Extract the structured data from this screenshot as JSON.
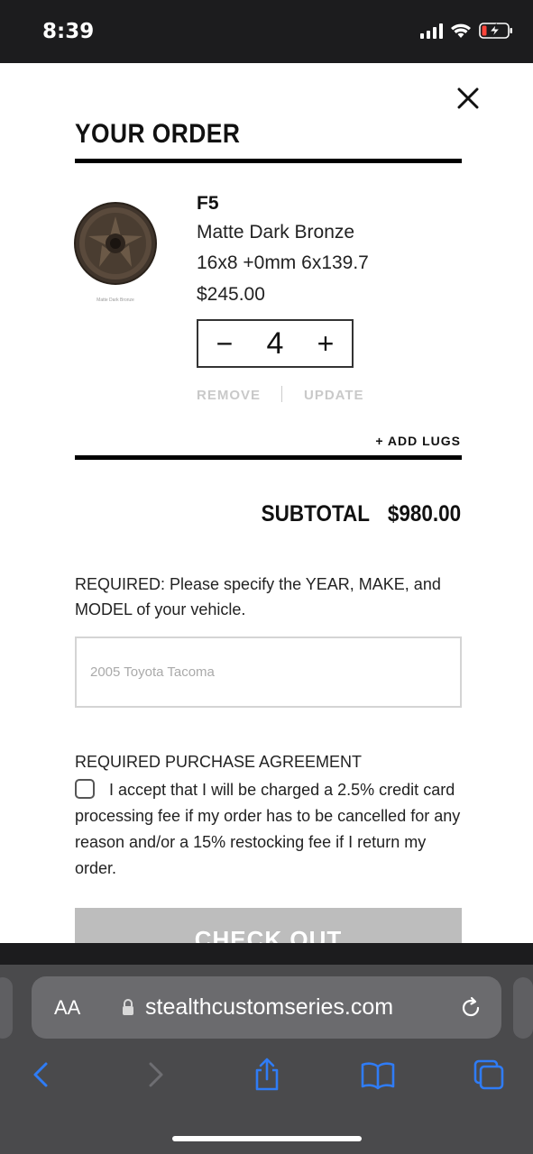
{
  "status_bar": {
    "time": "8:39"
  },
  "order": {
    "title": "YOUR ORDER",
    "item": {
      "name": "F5",
      "finish": "Matte Dark Bronze",
      "spec": "16x8 +0mm 6x139.7",
      "price": "$245.00",
      "image_caption": "Matte Dark Bronze",
      "quantity": "4",
      "minus_symbol": "−",
      "plus_symbol": "+"
    },
    "remove_label": "REMOVE",
    "update_label": "UPDATE",
    "add_lugs_label": "+ ADD LUGS",
    "subtotal_label": "SUBTOTAL",
    "subtotal_value": "$980.00",
    "required_note": "REQUIRED: Please specify the YEAR, MAKE, and MODEL of your vehicle.",
    "vehicle_placeholder": "2005 Toyota Tacoma",
    "agreement_heading": "REQUIRED PURCHASE AGREEMENT",
    "agreement_text": "I accept that I will be charged a 2.5% credit card processing fee if my order has to be cancelled for any reason and/or a 15% restocking fee if I return my order.",
    "agreement_checked": false,
    "checkout_label": "CHECK OUT"
  },
  "browser": {
    "text_size_label": "AA",
    "url": "stealthcustomseries.com"
  },
  "icons": {
    "close": "close-icon",
    "lock": "lock-icon",
    "reload": "reload-icon",
    "back": "back-icon",
    "forward": "forward-icon",
    "share": "share-icon",
    "bookmarks": "bookmarks-icon",
    "tabs": "tabs-icon"
  },
  "colors": {
    "accent": "#2f7cf6",
    "checkout_disabled": "#bdbdbd",
    "wheel_bronze": "#5a4a3c"
  }
}
